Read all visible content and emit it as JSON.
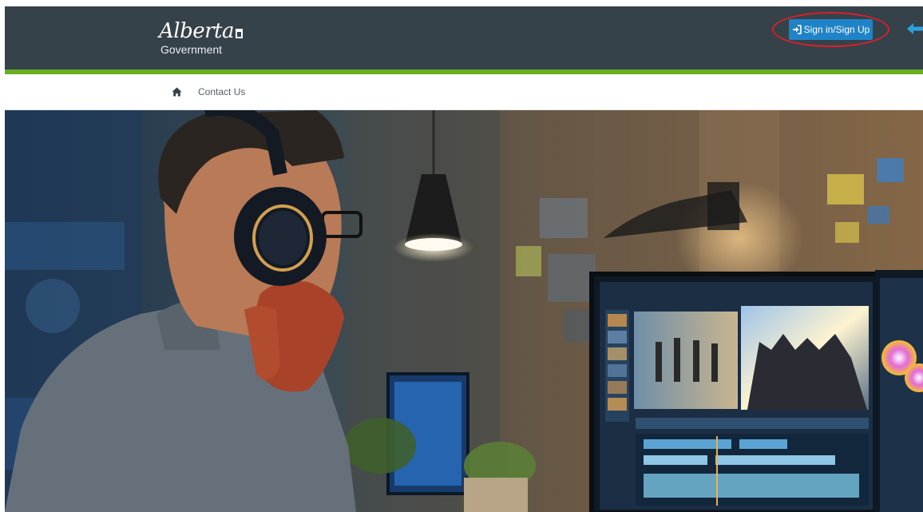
{
  "header": {
    "logo": {
      "script_text": "Alberta",
      "subtitle": "Government"
    },
    "signin_button": {
      "label": "Sign in/Sign Up",
      "icon": "sign-in-icon"
    }
  },
  "nav": {
    "home_icon": "home-icon",
    "links": [
      {
        "label": "Contact Us"
      }
    ]
  },
  "hero": {
    "image_icon": "video-editor-photo"
  },
  "colors": {
    "header_bg": "#36424a",
    "accent_green": "#6ab023",
    "button_blue": "#1f83c7",
    "annotation_red": "#d9202a",
    "annotation_arrow_blue": "#29a3dd"
  }
}
